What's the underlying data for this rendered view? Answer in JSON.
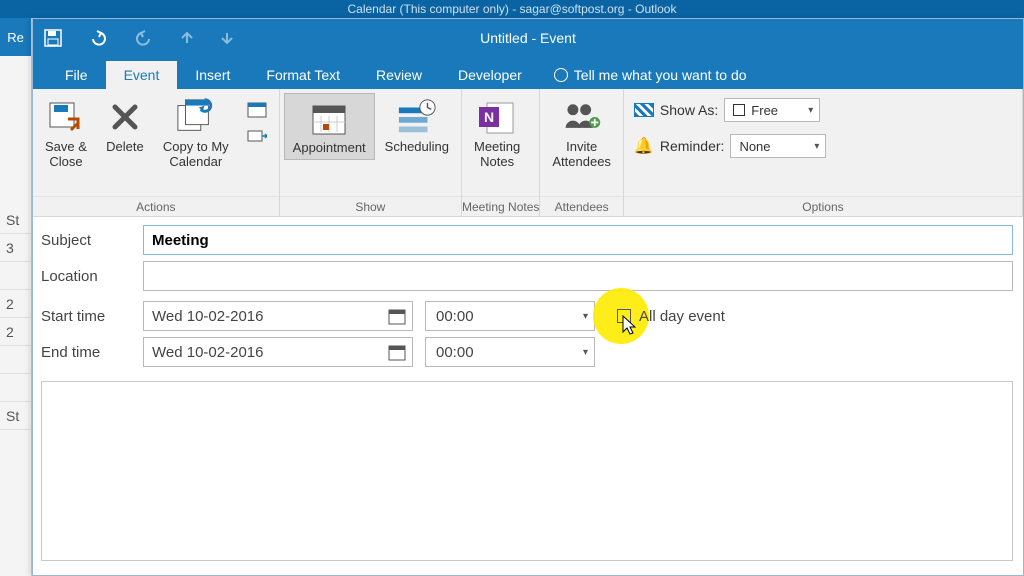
{
  "app_title": "Calendar (This computer only) - sagar@softpost.org - Outlook",
  "window_title": "Untitled - Event",
  "bg_sliver": "Re",
  "bg_rows": [
    "St",
    "3",
    "",
    "2",
    "2",
    "",
    "",
    "St"
  ],
  "tabs": {
    "file": "File",
    "event": "Event",
    "insert": "Insert",
    "format_text": "Format Text",
    "review": "Review",
    "developer": "Developer",
    "tell_me": "Tell me what you want to do"
  },
  "ribbon": {
    "actions": {
      "save_close": "Save &\nClose",
      "delete": "Delete",
      "copy_cal": "Copy to My\nCalendar",
      "label": "Actions"
    },
    "show": {
      "appointment": "Appointment",
      "scheduling": "Scheduling",
      "label": "Show"
    },
    "meeting_notes": {
      "btn": "Meeting\nNotes",
      "label": "Meeting Notes"
    },
    "attendees": {
      "invite": "Invite\nAttendees",
      "label": "Attendees"
    },
    "options": {
      "show_as": "Show As:",
      "show_as_val": "Free",
      "reminder": "Reminder:",
      "reminder_val": "None",
      "label": "Options"
    }
  },
  "form": {
    "subject_label": "Subject",
    "subject_value": "Meeting",
    "location_label": "Location",
    "location_value": "",
    "start_label": "Start time",
    "end_label": "End time",
    "start_date": "Wed 10-02-2016",
    "start_time": "00:00",
    "end_date": "Wed 10-02-2016",
    "end_time": "00:00",
    "all_day": "All day event"
  }
}
